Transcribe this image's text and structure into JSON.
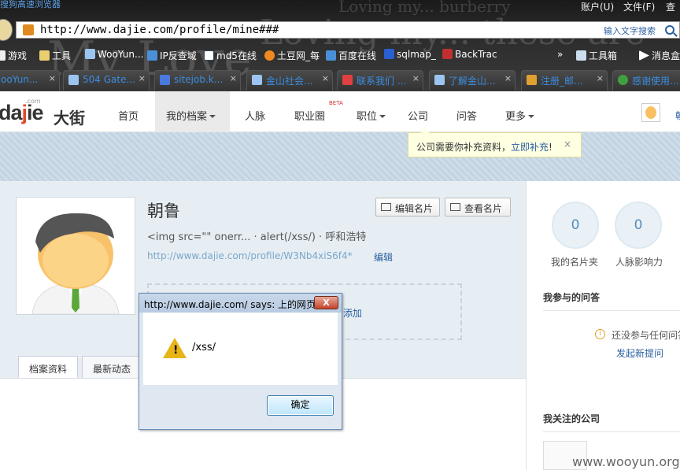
{
  "browser": {
    "app_title": "搜狗高速浏览器",
    "menu": [
      "账户(U)",
      "文件(F)",
      "查"
    ],
    "address_url": "http://www.dajie.com/profile/mine###",
    "address_hint": "输入文字搜索",
    "favorites": [
      {
        "label": "游戏",
        "icon": "folder-icon"
      },
      {
        "label": "工具",
        "icon": "folder-icon"
      },
      {
        "label": "WooYun...",
        "icon": "page-icon"
      },
      {
        "label": "IP反查域",
        "icon": "page-icon"
      },
      {
        "label": "md5在线",
        "icon": "grid-icon"
      },
      {
        "label": "土豆网_每",
        "icon": "tudou-icon"
      },
      {
        "label": "百度在线",
        "icon": "page-icon"
      },
      {
        "label": "sqlmap_",
        "icon": "baidu-icon"
      },
      {
        "label": "BackTrac",
        "icon": "dragon-icon"
      },
      {
        "label": "»",
        "icon": ""
      },
      {
        "label": "工具箱",
        "icon": "toolbox-icon"
      },
      {
        "label": "消息盒",
        "icon": "message-icon"
      }
    ],
    "tabs": [
      {
        "label": "ooYun...",
        "color": "#3a8de0"
      },
      {
        "label": "504 Gate...",
        "color": "#6a9fd4"
      },
      {
        "label": "sitejob.k...",
        "color": "#4a7ae0"
      },
      {
        "label": "金山社会...",
        "color": "#6a9fd4"
      },
      {
        "label": "联系我们 ...",
        "color": "#e04040"
      },
      {
        "label": "了解金山...",
        "color": "#6a9fd4"
      },
      {
        "label": "注册_邮...",
        "color": "#e0a030"
      },
      {
        "label": "感谢使用...",
        "color": "#40a040"
      }
    ]
  },
  "site": {
    "logo_en_pre": "da",
    "logo_e": "j",
    "logo_en_post": "ie",
    "logo_com": ".com",
    "logo_cn": "大街",
    "nav": [
      "首页",
      "我的档案",
      "人脉",
      "职业圈",
      "职位",
      "公司",
      "问答",
      "更多"
    ],
    "beta": "BETA",
    "user_name": "朝",
    "tooltip": {
      "text": "公司需要你补充资料，",
      "link": "立即补充",
      "after": "!",
      "close": "×"
    }
  },
  "profile": {
    "name": "朝鲁",
    "edit_card": "编辑名片",
    "view_card": "查看名片",
    "headline": "<img src=\"\" onerr... · alert(/xss/) · 呼和浩特",
    "url": "http://www.dajie.com/profile/W3Nb4xiS6f4*",
    "edit": "编辑",
    "add": "添加",
    "tabs": [
      "档案资料",
      "最新动态"
    ]
  },
  "sidebar": {
    "stats": [
      {
        "value": "0",
        "label": "我的名片夹"
      },
      {
        "value": "0",
        "label": "人脉影响力"
      }
    ],
    "qa_title": "我参与的问答",
    "qa_empty": "还没参与任何问答",
    "qa_ask": "发起新提问",
    "company_title": "我关注的公司"
  },
  "dialog": {
    "title": "http://www.dajie.com/ says: 上的网页",
    "message": "/xss/",
    "ok": "确定",
    "close": "X"
  },
  "watermark": "www.wooyun.org"
}
